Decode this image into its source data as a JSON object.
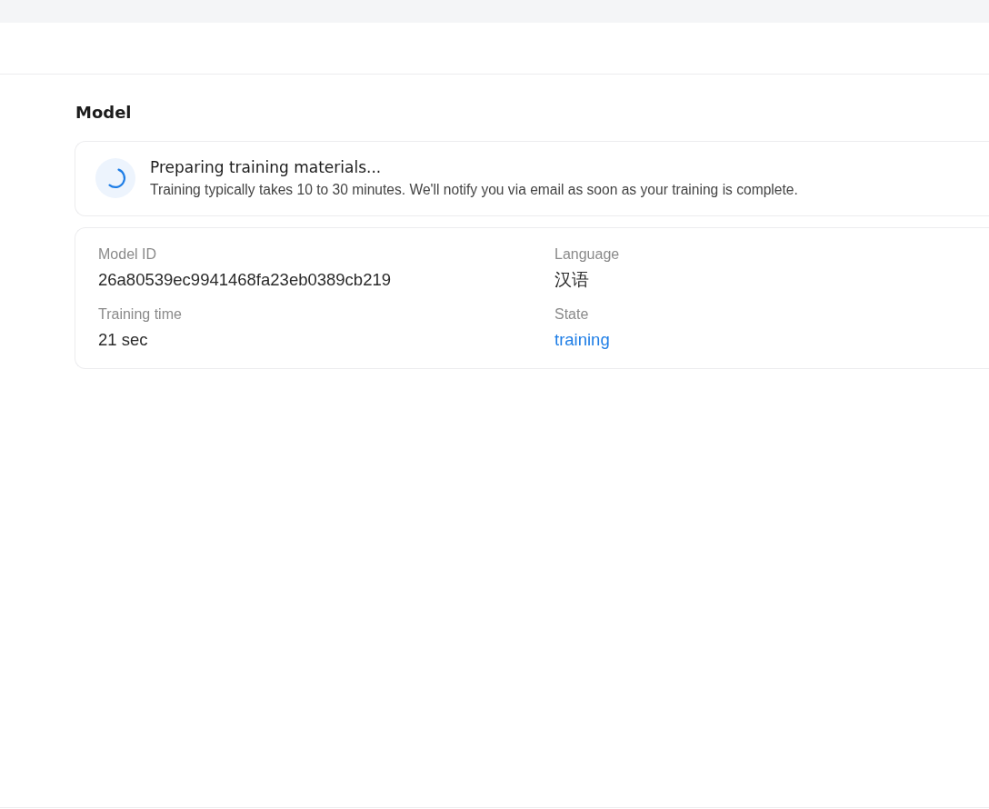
{
  "section_title": "Model",
  "status_banner": {
    "title": "Preparing training materials...",
    "message": "Training typically takes 10 to 30 minutes. We'll notify you via email as soon as your training is complete."
  },
  "details": [
    {
      "label": "Model ID",
      "value": "26a80539ec9941468fa23eb0389cb219",
      "kind": "text"
    },
    {
      "label": "Language",
      "value": "汉语",
      "kind": "text"
    },
    {
      "label": "Training time",
      "value": "21 sec",
      "kind": "text"
    },
    {
      "label": "State",
      "value": "training",
      "kind": "status"
    }
  ]
}
